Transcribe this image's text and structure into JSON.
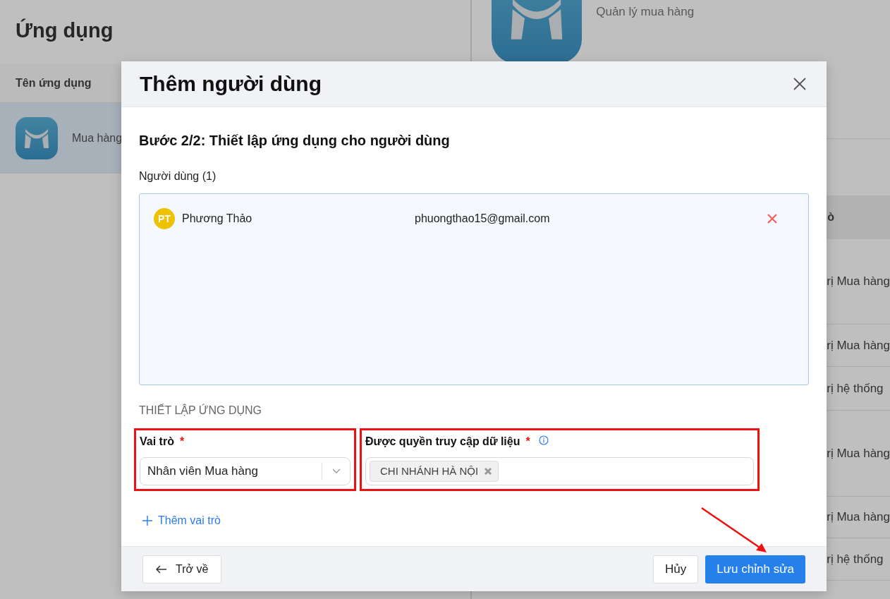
{
  "page": {
    "title": "Ứng dụng",
    "list_header": "Tên ứng dụng",
    "apps": [
      {
        "name": "Mua hàng",
        "selected": true
      }
    ]
  },
  "detail": {
    "app_title": "Quản lý mua hàng",
    "column_header": "ò",
    "rows": [
      "rị Mua hàng",
      "rị Mua hàng",
      "rị hệ thống",
      "rị Mua hàng",
      "rị Mua hàng",
      "rị hệ thống"
    ]
  },
  "modal": {
    "title": "Thêm người dùng",
    "step": "Bước 2/2: Thiết lập ứng dụng cho người dùng",
    "users_label": "Người dùng (1)",
    "users": [
      {
        "initials": "PT",
        "name": "Phương Thảo",
        "email": "phuongthao15@gmail.com"
      }
    ],
    "section": "THIẾT LẬP ỨNG DỤNG",
    "role": {
      "label": "Vai trò",
      "required_mark": "*",
      "value": "Nhân viên Mua hàng",
      "highlighted": true
    },
    "access": {
      "label": "Được quyền truy cập dữ liệu",
      "required_mark": "*",
      "tags": [
        "CHI NHÁNH HÀ NỘI"
      ],
      "highlighted": true
    },
    "add_role": "Thêm vai trò",
    "back": "Trở về",
    "cancel": "Hủy",
    "save": "Lưu chỉnh sửa"
  },
  "annotations": [
    {
      "kind": "arrow"
    }
  ]
}
